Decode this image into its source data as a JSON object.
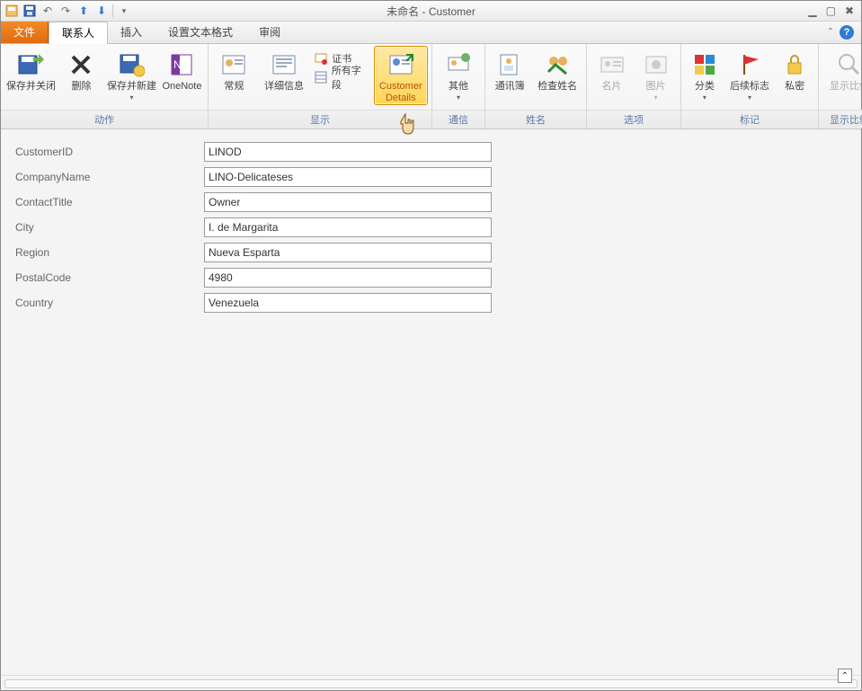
{
  "title": "未命名 - Customer",
  "qat": {
    "save": "save",
    "undo": "undo",
    "redo": "redo",
    "up": "up",
    "down": "down"
  },
  "tabs": {
    "file": "文件",
    "items": [
      {
        "label": "联系人",
        "active": true
      },
      {
        "label": "插入"
      },
      {
        "label": "设置文本格式"
      },
      {
        "label": "审阅"
      }
    ]
  },
  "ribbon": {
    "groups": [
      {
        "name": "动作",
        "items": [
          {
            "id": "save-close",
            "label": "保存并关闭",
            "icon": "save-close",
            "type": "big"
          },
          {
            "id": "delete",
            "label": "删除",
            "icon": "delete",
            "type": "big"
          },
          {
            "id": "save-new",
            "label": "保存并新建",
            "icon": "save-new",
            "type": "big",
            "dropdown": true
          },
          {
            "id": "onenote",
            "label": "OneNote",
            "icon": "onenote",
            "type": "big"
          }
        ]
      },
      {
        "name": "显示",
        "items": [
          {
            "id": "general",
            "label": "常规",
            "icon": "card",
            "type": "big"
          },
          {
            "id": "details",
            "label": "详细信息",
            "icon": "card2",
            "type": "big"
          },
          {
            "id": "cert",
            "label": "证书",
            "icon": "cert",
            "type": "small"
          },
          {
            "id": "all-fields",
            "label": "所有字段",
            "icon": "fields",
            "type": "small"
          },
          {
            "id": "customer-details",
            "label": "Customer Details",
            "icon": "cust",
            "type": "big",
            "highlight": true
          }
        ]
      },
      {
        "name": "通信",
        "items": [
          {
            "id": "other",
            "label": "其他",
            "icon": "other",
            "type": "big",
            "dropdown": true
          }
        ]
      },
      {
        "name": "姓名",
        "items": [
          {
            "id": "addrbook",
            "label": "通讯簿",
            "icon": "book",
            "type": "big"
          },
          {
            "id": "checkname",
            "label": "检查姓名",
            "icon": "check",
            "type": "big"
          }
        ]
      },
      {
        "name": "选项",
        "items": [
          {
            "id": "card",
            "label": "名片",
            "icon": "bizcard",
            "type": "big",
            "disabled": true
          },
          {
            "id": "picture",
            "label": "图片",
            "icon": "pic",
            "type": "big",
            "disabled": true,
            "dropdown": true
          }
        ]
      },
      {
        "name": "标记",
        "items": [
          {
            "id": "categorize",
            "label": "分类",
            "icon": "cat",
            "type": "big",
            "dropdown": true
          },
          {
            "id": "followup",
            "label": "后续标志",
            "icon": "flag",
            "type": "big",
            "dropdown": true
          },
          {
            "id": "private",
            "label": "私密",
            "icon": "lock",
            "type": "big"
          }
        ]
      },
      {
        "name": "显示比例",
        "items": [
          {
            "id": "zoom",
            "label": "显示比例",
            "icon": "zoom",
            "type": "big",
            "disabled": true
          }
        ]
      }
    ]
  },
  "form": {
    "fields": [
      {
        "label": "CustomerID",
        "value": "LINOD"
      },
      {
        "label": "CompanyName",
        "value": "LINO-Delicateses"
      },
      {
        "label": "ContactTitle",
        "value": "Owner"
      },
      {
        "label": "City",
        "value": "I. de Margarita"
      },
      {
        "label": "Region",
        "value": "Nueva Esparta"
      },
      {
        "label": "PostalCode",
        "value": "4980"
      },
      {
        "label": "Country",
        "value": "Venezuela"
      }
    ]
  },
  "win": {
    "min": "▁",
    "max": "▣",
    "close": "✕"
  }
}
